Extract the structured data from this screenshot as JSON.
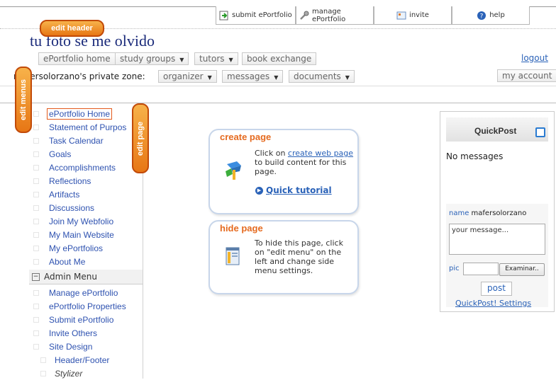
{
  "toolbar": {
    "submit": "submit ePortfolio",
    "manage": "manage ePortfolio",
    "invite": "invite",
    "help": "help"
  },
  "edit_tabs": {
    "header": "edit header",
    "menus": "edit menus",
    "page": "edit page"
  },
  "site_title": "tu foto se me olvido",
  "nav_main": [
    "ePortfolio home",
    "study groups",
    "tutors",
    "book exchange"
  ],
  "logout": "logout",
  "private_zone": {
    "label": "mafersolorzano's private zone:",
    "items": [
      "organizer",
      "messages",
      "documents"
    ]
  },
  "my_account": "my account",
  "side_menu": {
    "items": [
      "ePortfolio Home",
      "Statement of Purpos",
      "Task Calendar",
      "Goals",
      "Accomplishments",
      "Reflections",
      "Artifacts",
      "Discussions",
      "Join My Webfolio",
      "My Main Website",
      "My ePortfolios",
      "About Me"
    ],
    "admin_title": "Admin Menu",
    "admin_items": [
      "Manage ePortfolio",
      "ePortfolio Properties",
      "Submit ePortfolio",
      "Invite Others",
      "Site Design"
    ],
    "sub_items": [
      "Header/Footer",
      "Stylizer"
    ]
  },
  "create_card": {
    "title": "create page",
    "text_before": "Click on ",
    "link": "create web page",
    "text_after": " to build content for this page.",
    "tutorial": "Quick tutorial"
  },
  "hide_card": {
    "title": "hide page",
    "text": "To hide this page, click on \"edit menu\" on the left and change side menu settings."
  },
  "quickpost": {
    "title": "QuickPost",
    "no_messages": "No messages",
    "name_label": "name",
    "name_value": "mafersolorzano",
    "message_placeholder": "your message...",
    "pic_label": "pic",
    "browse": "Examinar..",
    "post": "post",
    "settings": "QuickPost! Settings"
  }
}
